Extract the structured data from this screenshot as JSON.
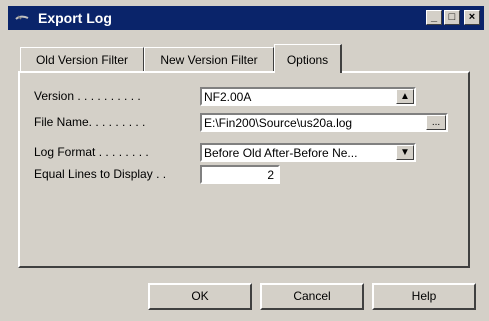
{
  "window": {
    "title": "Export Log"
  },
  "titlebar_buttons": {
    "minimize": "_",
    "maximize": "□",
    "close": "×"
  },
  "tabs": [
    {
      "label": "Old Version Filter"
    },
    {
      "label": "New Version Filter"
    },
    {
      "label": "Options"
    }
  ],
  "form": {
    "version_label": "Version . . . . . . . . . .",
    "version_value": "NF2.00A",
    "file_label": "File Name. . . . . . . . .",
    "file_value": "E:\\Fin200\\Source\\us20a.log",
    "format_label": "Log Format . . . . . . . .",
    "format_value": "Before Old After-Before Ne...",
    "equal_label": "Equal Lines to Display . .",
    "equal_value": "2"
  },
  "buttons": {
    "ok": "OK",
    "cancel": "Cancel",
    "help": "Help",
    "browse": "...",
    "version_up": "▲",
    "format_down": "▼"
  },
  "colors": {
    "titlebar": "#0a246a",
    "face": "#d4d0c8"
  }
}
